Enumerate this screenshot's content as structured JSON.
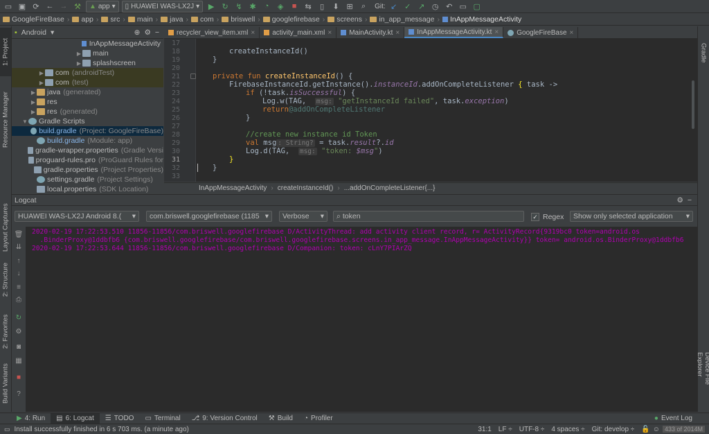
{
  "toolbar": {
    "run_config": "app",
    "device": "HUAWEI WAS-LX2J",
    "git_label": "Git:"
  },
  "navbar": {
    "crumbs": [
      "GoogleFireBase",
      "app",
      "src",
      "main",
      "java",
      "com",
      "briswell",
      "googlefirebase",
      "screens",
      "in_app_message",
      "InAppMessageActivity"
    ]
  },
  "left_stripe": {
    "project": "1: Project",
    "resource_manager": "Resource Manager",
    "layout_captures": "Layout Captures",
    "structure": "2: Structure",
    "favorites": "2: Favorites",
    "build_variants": "Build Variants"
  },
  "right_stripe": {
    "gradle": "Gradle",
    "device_file_explorer": "Device File Explorer"
  },
  "project": {
    "view_mode": "Android",
    "items": [
      {
        "label": "InAppMessageActivity",
        "suffix": ""
      },
      {
        "label": "main",
        "suffix": ""
      },
      {
        "label": "splashscreen",
        "suffix": ""
      },
      {
        "label": "com",
        "suffix": "(androidTest)"
      },
      {
        "label": "com",
        "suffix": "(test)"
      },
      {
        "label": "java",
        "suffix": "(generated)"
      },
      {
        "label": "res",
        "suffix": ""
      },
      {
        "label": "res",
        "suffix": "(generated)"
      },
      {
        "label": "Gradle Scripts",
        "suffix": ""
      },
      {
        "label": "build.gradle",
        "suffix": "(Project: GoogleFireBase)"
      },
      {
        "label": "build.gradle",
        "suffix": "(Module: app)"
      },
      {
        "label": "gradle-wrapper.properties",
        "suffix": "(Gradle Versi"
      },
      {
        "label": "proguard-rules.pro",
        "suffix": "(ProGuard Rules for"
      },
      {
        "label": "gradle.properties",
        "suffix": "(Project Properties)"
      },
      {
        "label": "settings.gradle",
        "suffix": "(Project Settings)"
      },
      {
        "label": "local.properties",
        "suffix": "(SDK Location)"
      }
    ]
  },
  "editor_tabs": [
    {
      "label": "recycler_view_item.xml",
      "type": "xml"
    },
    {
      "label": "activity_main.xml",
      "type": "xml"
    },
    {
      "label": "MainActivity.kt",
      "type": "kt"
    },
    {
      "label": "InAppMessageActivity.kt",
      "type": "kt"
    },
    {
      "label": "GoogleFireBase",
      "type": "gradle"
    }
  ],
  "editor": {
    "line_numbers": [
      "17",
      "18",
      "19",
      "20",
      "21",
      "22",
      "23",
      "24",
      "25",
      "26",
      "27",
      "28",
      "29",
      "30",
      "31",
      "32",
      "33"
    ],
    "hints": {
      "msg1": "msg:",
      "type": ": String?",
      "msg2": "msg:"
    },
    "code": {
      "l17": "createInstanceId()",
      "l18": "}",
      "l20_kw": "private fun ",
      "l20_fn": "createInstanceId",
      "l20_rest": "() {",
      "l21_a": "FirebaseInstanceId.getInstance().",
      "l21_b": "instanceId",
      "l21_c": ".addOnCompleteListener ",
      "l21_d": "{",
      "l21_e": " task ->",
      "l22_kw": "if ",
      "l22_a": "(!task.",
      "l22_b": "isSuccessful",
      "l22_c": ") {",
      "l23_a": "Log.w(TAG,  ",
      "l23_str": "\"getInstanceId failed\"",
      "l23_b": ", task.",
      "l23_c": "exception",
      "l23_d": ")",
      "l24_kw": "return",
      "l24_lbl": "@addOnCompleteListener",
      "l25": "}",
      "l27": "//create new instance id Token",
      "l28_kw": "val ",
      "l28_a": "msg",
      "l28_b": " = task.",
      "l28_c": "result",
      "l28_d": "?.",
      "l28_e": "id",
      "l29_a": "Log.d(TAG,  ",
      "l29_str": "\"token: ",
      "l29_var": "$msg",
      "l29_end": "\"",
      "l29_close": ")",
      "l30": "}",
      "l31": "}"
    },
    "breadcrumbs": [
      "InAppMessageActivity",
      "createInstanceId()",
      "...addOnCompleteListener{...}"
    ]
  },
  "logcat": {
    "title": "Logcat",
    "device": "HUAWEI WAS-LX2J Android 8.(",
    "process": "com.briswell.googlefirebase (1185",
    "level": "Verbose",
    "search": "token",
    "regex_label": "Regex",
    "filter": "Show only selected application",
    "lines": [
      "2020-02-19 17:22:53.510 11856-11856/com.briswell.googlefirebase D/ActivityThread: add activity client record, r= ActivityRecord{9319bc0 token=android.os",
      "  .BinderProxy@1ddbfb6 {com.briswell.googlefirebase/com.briswell.googlefirebase.screens.in_app_message.InAppMessageActivity}} token= android.os.BinderProxy@1ddbfb6",
      "2020-02-19 17:22:53.644 11856-11856/com.briswell.googlefirebase D/Companion: token: cLnY7PIArZQ"
    ]
  },
  "bottom_tabs": [
    {
      "label": "4: Run"
    },
    {
      "label": "6: Logcat"
    },
    {
      "label": "TODO"
    },
    {
      "label": "Terminal"
    },
    {
      "label": "9: Version Control"
    },
    {
      "label": "Build"
    },
    {
      "label": "Profiler"
    }
  ],
  "event_log": "Event Log",
  "status": {
    "message": "Install successfully finished in 6 s 703 ms. (a minute ago)",
    "position": "31:1",
    "line_sep": "LF ÷",
    "encoding": "UTF-8 ÷",
    "indent": "4 spaces ÷",
    "git": "Git: develop ÷",
    "memory": "433 of 2014M"
  },
  "colors": {
    "background": "#3c3f41",
    "editor_bg": "#2b2b2b",
    "log_text": "#b200b2",
    "accent": "#4a88c7"
  }
}
